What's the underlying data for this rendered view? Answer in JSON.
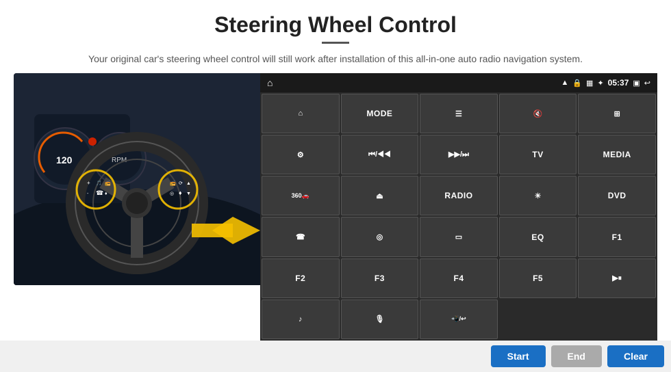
{
  "header": {
    "title": "Steering Wheel Control",
    "subtitle": "Your original car's steering wheel control will still work after installation of this all-in-one auto radio navigation system."
  },
  "status_bar": {
    "time": "05:37",
    "icons": [
      "wifi",
      "lock",
      "sim",
      "bluetooth",
      "battery",
      "window",
      "back"
    ]
  },
  "buttons": [
    [
      {
        "label": "⌂",
        "type": "icon",
        "name": "home-btn"
      },
      {
        "label": "MODE",
        "type": "text",
        "name": "mode-btn"
      },
      {
        "label": "≡",
        "type": "icon",
        "name": "list-btn"
      },
      {
        "label": "🔇",
        "type": "icon",
        "name": "mute-btn"
      },
      {
        "label": "⊞",
        "type": "icon",
        "name": "grid-btn"
      }
    ],
    [
      {
        "label": "⚙",
        "type": "icon",
        "name": "settings-btn"
      },
      {
        "label": "⏮",
        "type": "icon",
        "name": "prev-btn"
      },
      {
        "label": "⏭",
        "type": "icon",
        "name": "next-btn"
      },
      {
        "label": "TV",
        "type": "text",
        "name": "tv-btn"
      },
      {
        "label": "MEDIA",
        "type": "text",
        "name": "media-btn"
      }
    ],
    [
      {
        "label": "360",
        "type": "text",
        "name": "360-btn"
      },
      {
        "label": "⏏",
        "type": "icon",
        "name": "eject-btn"
      },
      {
        "label": "RADIO",
        "type": "text",
        "name": "radio-btn"
      },
      {
        "label": "☀",
        "type": "icon",
        "name": "brightness-btn"
      },
      {
        "label": "DVD",
        "type": "text",
        "name": "dvd-btn"
      }
    ],
    [
      {
        "label": "☎",
        "type": "icon",
        "name": "phone-btn"
      },
      {
        "label": "◎",
        "type": "icon",
        "name": "nav-btn"
      },
      {
        "label": "▭",
        "type": "icon",
        "name": "screen-btn"
      },
      {
        "label": "EQ",
        "type": "text",
        "name": "eq-btn"
      },
      {
        "label": "F1",
        "type": "text",
        "name": "f1-btn"
      }
    ],
    [
      {
        "label": "F2",
        "type": "text",
        "name": "f2-btn"
      },
      {
        "label": "F3",
        "type": "text",
        "name": "f3-btn"
      },
      {
        "label": "F4",
        "type": "text",
        "name": "f4-btn"
      },
      {
        "label": "F5",
        "type": "text",
        "name": "f5-btn"
      },
      {
        "label": "▶⏸",
        "type": "icon",
        "name": "playpause-btn"
      }
    ],
    [
      {
        "label": "♪",
        "type": "icon",
        "name": "music-btn"
      },
      {
        "label": "🎙",
        "type": "icon",
        "name": "mic-btn"
      },
      {
        "label": "📲",
        "type": "icon",
        "name": "call-btn"
      },
      {
        "label": "",
        "type": "empty",
        "name": "empty1"
      },
      {
        "label": "",
        "type": "empty",
        "name": "empty2"
      }
    ]
  ],
  "bottom_buttons": {
    "start": "Start",
    "end": "End",
    "clear": "Clear"
  }
}
